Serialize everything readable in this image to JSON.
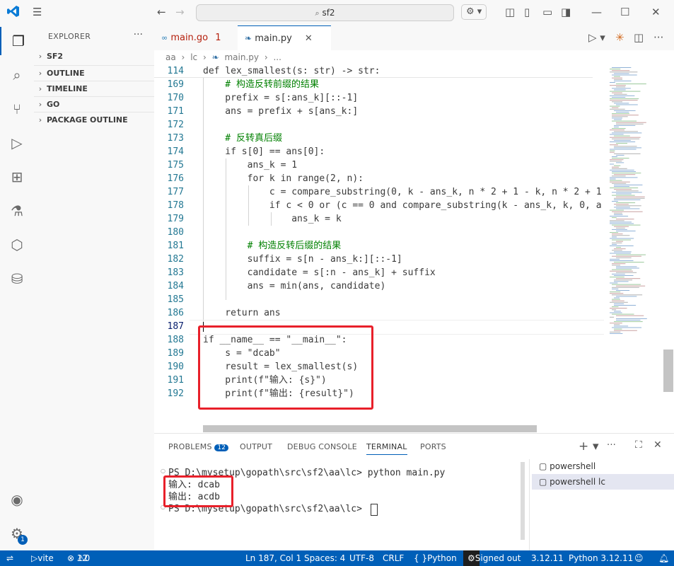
{
  "titlebar": {
    "search": "sf2",
    "icons": [
      "vscode-logo-icon",
      "menu-icon",
      "back-arrow-icon",
      "forward-arrow-icon",
      "copilot-icon",
      "layout-icon",
      "panel-icon",
      "sidebar-icon",
      "minimize-icon",
      "maximize-icon",
      "close-icon"
    ]
  },
  "activitybar": {
    "items": [
      "explorer-icon",
      "search-icon",
      "source-control-icon",
      "run-debug-icon",
      "extensions-icon",
      "testing-icon",
      "remote-icon",
      "database-icon"
    ],
    "settings_badge": "1"
  },
  "sidebar": {
    "title": "EXPLORER",
    "sections": [
      "SF2",
      "OUTLINE",
      "TIMELINE",
      "GO",
      "PACKAGE OUTLINE"
    ]
  },
  "tabs": [
    {
      "label": "main.go",
      "problems": "1"
    },
    {
      "label": "main.py"
    }
  ],
  "breadcrumb": [
    "aa",
    "lc",
    "main.py",
    "..."
  ],
  "editor": {
    "lines": [
      {
        "n": "114",
        "text": "def lex_smallest(s: str) -> str:"
      },
      {
        "n": "169",
        "text": "    # 构造反转前缀的结果"
      },
      {
        "n": "170",
        "text": "    prefix = s[:ans_k][::-1]"
      },
      {
        "n": "171",
        "text": "    ans = prefix + s[ans_k:]"
      },
      {
        "n": "172",
        "text": ""
      },
      {
        "n": "173",
        "text": "    # 反转真后缀"
      },
      {
        "n": "174",
        "text": "    if s[0] == ans[0]:"
      },
      {
        "n": "175",
        "text": "        ans_k = 1"
      },
      {
        "n": "176",
        "text": "        for k in range(2, n):"
      },
      {
        "n": "177",
        "text": "            c = compare_substring(0, k - ans_k, n * 2 + 1 - k, n * 2 + 1"
      },
      {
        "n": "178",
        "text": "            if c < 0 or (c == 0 and compare_substring(k - ans_k, k, 0, a"
      },
      {
        "n": "179",
        "text": "                ans_k = k"
      },
      {
        "n": "180",
        "text": ""
      },
      {
        "n": "181",
        "text": "        # 构造反转后缀的结果"
      },
      {
        "n": "182",
        "text": "        suffix = s[n - ans_k:][::-1]"
      },
      {
        "n": "183",
        "text": "        candidate = s[:n - ans_k] + suffix"
      },
      {
        "n": "184",
        "text": "        ans = min(ans, candidate)"
      },
      {
        "n": "185",
        "text": ""
      },
      {
        "n": "186",
        "text": "    return ans"
      },
      {
        "n": "187",
        "text": ""
      },
      {
        "n": "188",
        "text": "if __name__ == \"__main__\":"
      },
      {
        "n": "189",
        "text": "    s = \"dcab\""
      },
      {
        "n": "190",
        "text": "    result = lex_smallest(s)"
      },
      {
        "n": "191",
        "text": "    print(f\"输入: {s}\")"
      },
      {
        "n": "192",
        "text": "    print(f\"输出: {result}\")"
      }
    ]
  },
  "panel": {
    "tabs": [
      "PROBLEMS",
      "OUTPUT",
      "DEBUG CONSOLE",
      "TERMINAL",
      "PORTS"
    ],
    "problems_count": "12",
    "terminal_lines": [
      "PS D:\\mysetup\\gopath\\src\\sf2\\aa\\lc> python main.py",
      "输入: dcab",
      "输出: acdb",
      "PS D:\\mysetup\\gopath\\src\\sf2\\aa\\lc> "
    ],
    "terminals": [
      "powershell",
      "powershell  lc"
    ]
  },
  "statusbar": {
    "vite": "vite",
    "errors": "12",
    "warnings": "0",
    "position": "Ln 187, Col 1",
    "spaces": "Spaces: 4",
    "encoding": "UTF-8",
    "eol": "CRLF",
    "language": "Python",
    "account": "Signed out",
    "python_version": "3.12.11",
    "interpreter": "Python 3.12.11"
  },
  "colors": {
    "accent": "#005fb8",
    "highlight_box": "#e8202a"
  }
}
